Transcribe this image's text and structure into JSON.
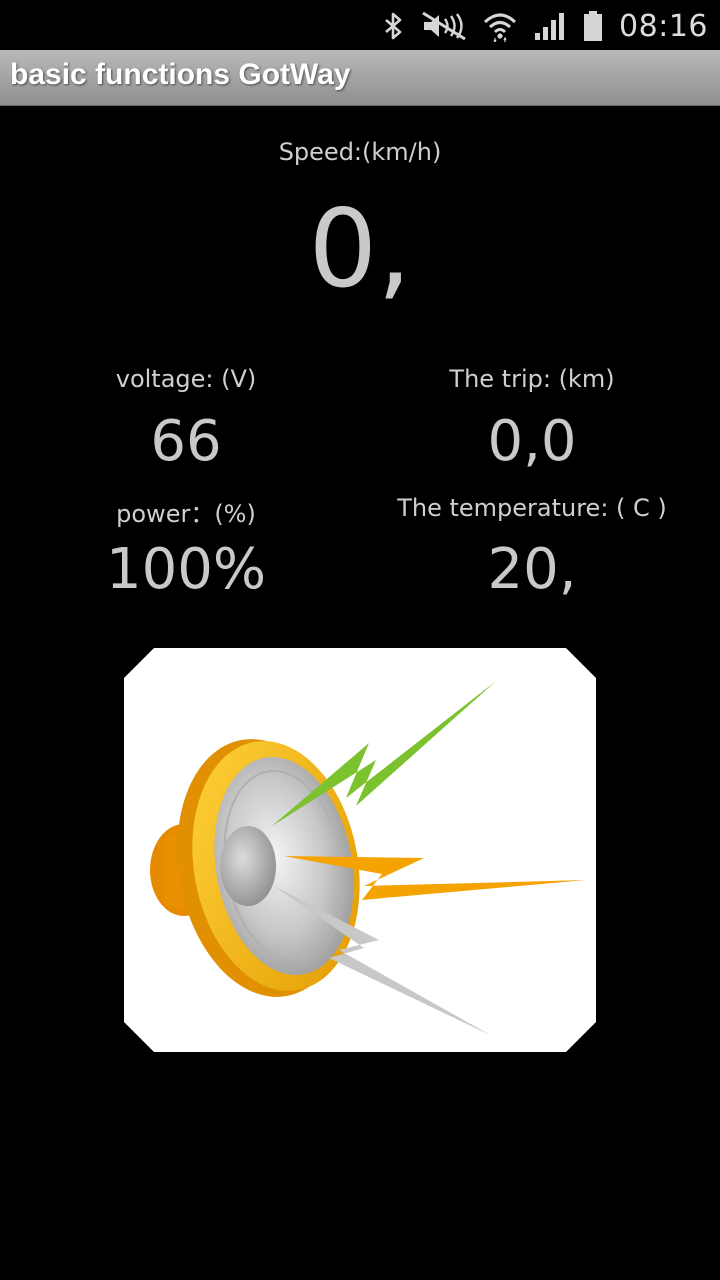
{
  "status_bar": {
    "time": "08:16",
    "icons": [
      "bluetooth-icon",
      "mute-icon",
      "wifi-icon",
      "signal-icon",
      "battery-icon"
    ]
  },
  "app_bar": {
    "title": "basic functions GotWay"
  },
  "speed": {
    "label": "Speed:(km/h)",
    "value": "0,"
  },
  "voltage": {
    "label": "voltage: (V)",
    "value": "66"
  },
  "trip": {
    "label": "The trip: (km)",
    "value": "0,0"
  },
  "power": {
    "label": "power：(%)",
    "value": "100%"
  },
  "temperature": {
    "label": "The temperature: ( C )",
    "value": "20,"
  },
  "speaker_button": {
    "icon": "speaker-icon"
  },
  "colors": {
    "background": "#000000",
    "title_bar": "#a6a6a6",
    "text": "#cfcfcf",
    "speaker_rim": "#f2b400",
    "bolt_green": "#7cc22e",
    "bolt_orange": "#f5a300",
    "bolt_gray": "#c8c8c8"
  }
}
